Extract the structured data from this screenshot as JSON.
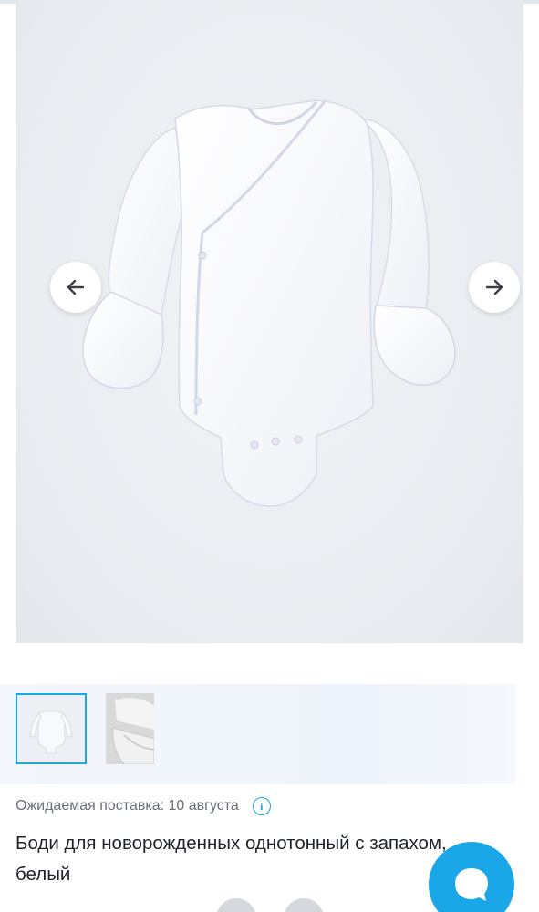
{
  "gallery": {
    "image_alt": "product-photo",
    "prev_icon": "arrow-left-icon",
    "next_icon": "arrow-right-icon"
  },
  "thumbnails": [
    {
      "name": "thumb-bodysuit-front",
      "selected": true
    },
    {
      "name": "thumb-bodysuit-detail",
      "selected": false
    }
  ],
  "delivery": {
    "label": "Ожидаемая поставка: 10 августа",
    "info_icon": "info-icon"
  },
  "product": {
    "title": "Боди для новорожденных однотонный с запахом, белый"
  },
  "chat": {
    "icon": "chat-bubble-icon"
  },
  "colors": {
    "accent": "#1aa7e8",
    "text": "#1f2329",
    "muted_text": "#6a6f77"
  }
}
